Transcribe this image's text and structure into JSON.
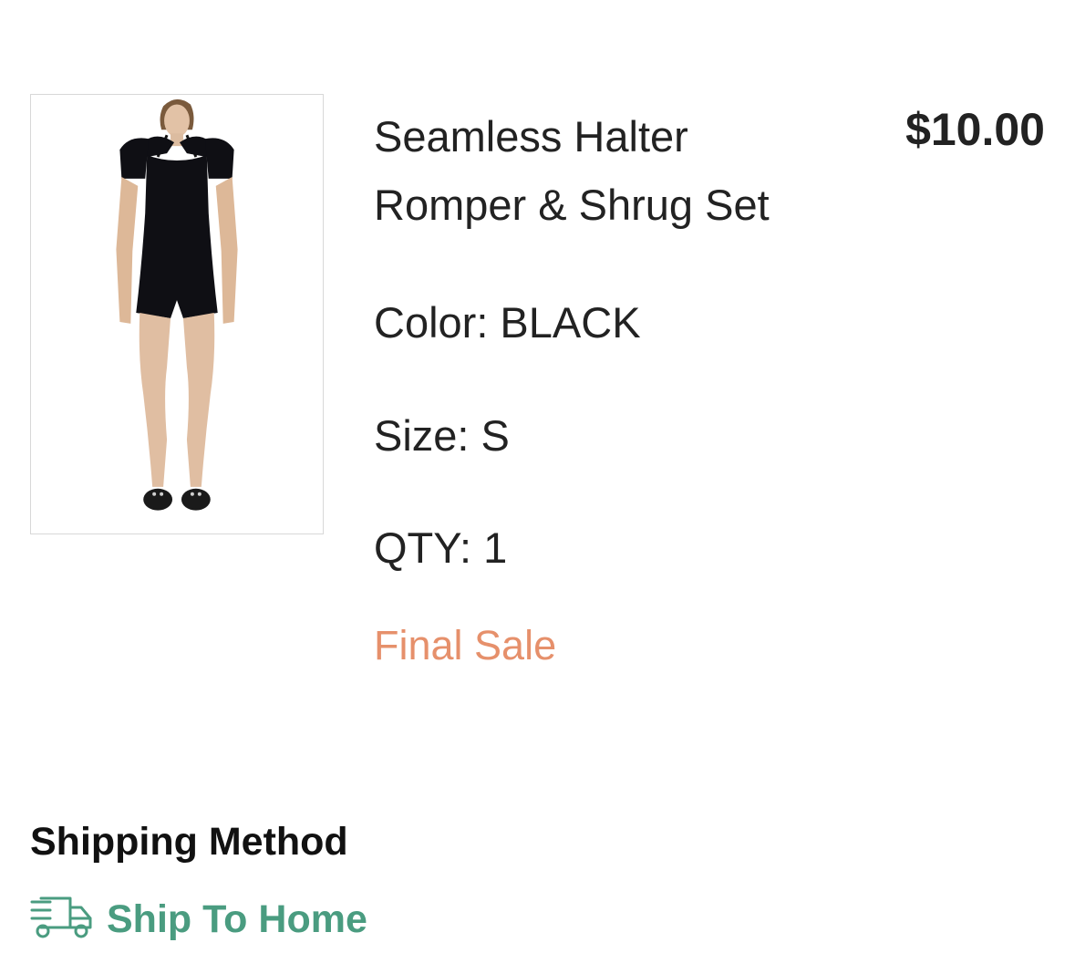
{
  "product": {
    "title_line1": "Seamless Halter",
    "title_line2": "Romper & Shrug Set",
    "price": "$10.00",
    "color": "Color: BLACK",
    "size": "Size: S",
    "qty": "QTY: 1",
    "final_sale": "Final Sale"
  },
  "shipping": {
    "heading": "Shipping Method",
    "method_label": "Ship To Home",
    "method_icon": "truck-icon"
  },
  "colors": {
    "final_sale": "#e6906b",
    "shipping_accent": "#4a9c80"
  }
}
